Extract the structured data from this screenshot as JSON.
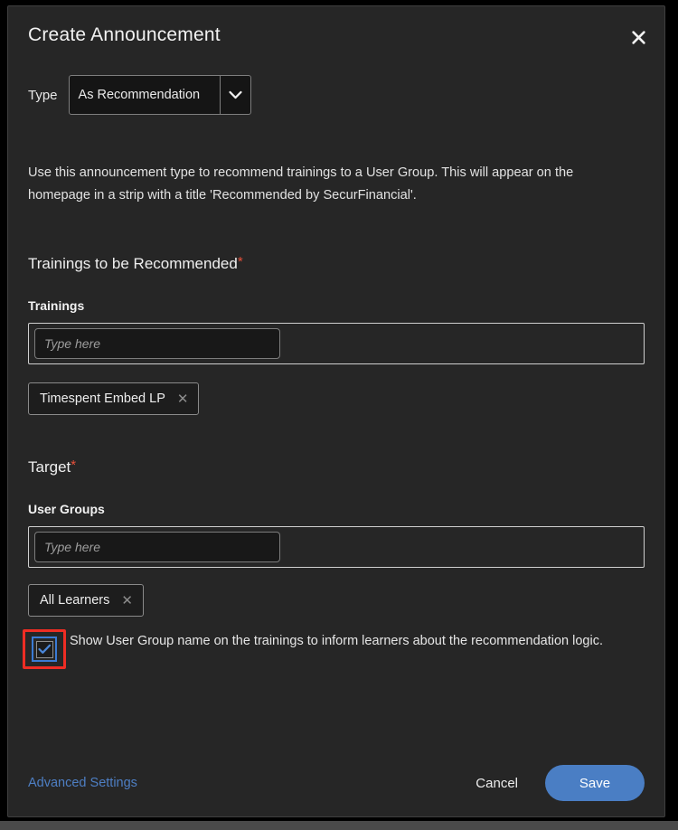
{
  "dialog": {
    "title": "Create Announcement",
    "close_icon": "close-icon"
  },
  "type_row": {
    "label": "Type",
    "selected": "As Recommendation",
    "chevron_icon": "chevron-down-icon"
  },
  "description": "Use this announcement type to recommend trainings to a User Group. This will appear on the homepage in a strip with a title 'Recommended by SecurFinancial'.",
  "trainings_section": {
    "heading": "Trainings to be Recommended",
    "required_marker": "*",
    "field_label": "Trainings",
    "input_placeholder": "Type here",
    "input_value": "",
    "chips": [
      {
        "label": "Timespent Embed LP",
        "remove_icon": "close-icon"
      }
    ]
  },
  "target_section": {
    "heading": "Target",
    "required_marker": "*",
    "field_label": "User Groups",
    "input_placeholder": "Type here",
    "input_value": "",
    "chips": [
      {
        "label": "All Learners",
        "remove_icon": "close-icon"
      }
    ]
  },
  "checkbox_option": {
    "checked": true,
    "check_icon": "check-icon",
    "text": "Show User Group name on the trainings to inform learners about the recommendation logic."
  },
  "footer": {
    "advanced_settings_label": "Advanced Settings",
    "cancel_label": "Cancel",
    "save_label": "Save"
  },
  "colors": {
    "dialog_bg": "#262626",
    "page_bg": "#000000",
    "accent_blue": "#4a7ec4",
    "link_blue": "#4e7fc4",
    "required_red": "#e8503a",
    "annotation_red": "#ee2d24",
    "focus_blue": "#3a7bd5"
  }
}
